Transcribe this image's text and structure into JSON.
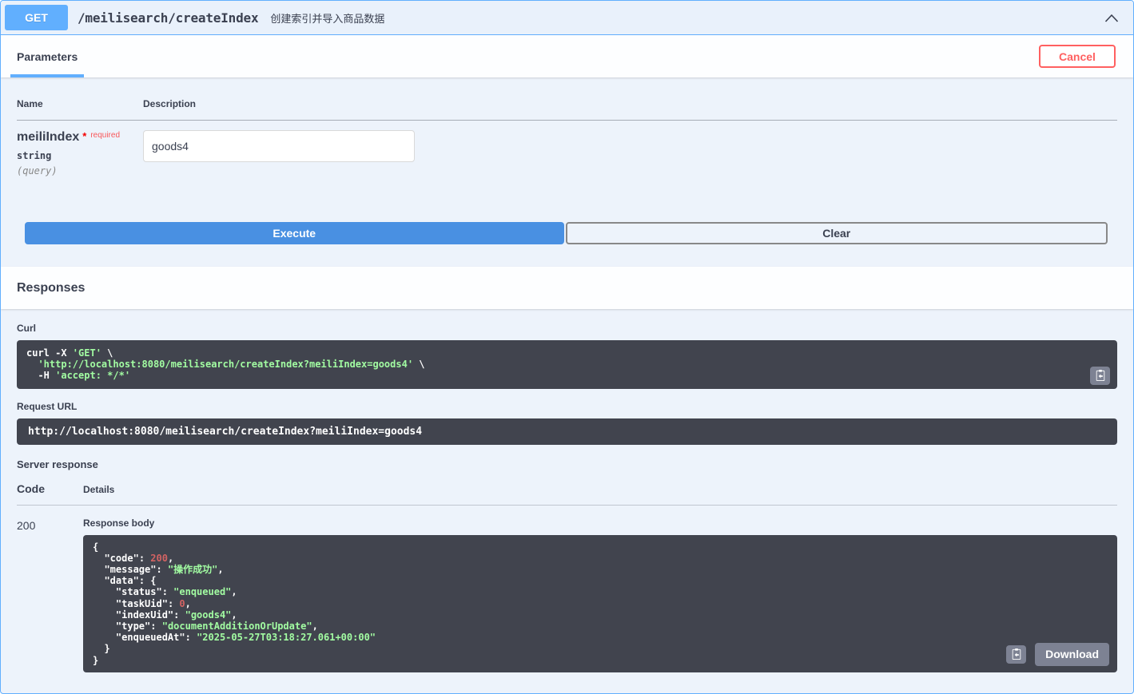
{
  "colors": {
    "method_get": "#61affe",
    "execute_blue": "#4990e2",
    "cancel_red": "#ff6060",
    "code_block_bg": "#41444e",
    "token_string_green": "#a2fca2",
    "token_number_red": "#d36363",
    "gray_button": "#7d8293"
  },
  "summary": {
    "method": "GET",
    "path": "/meilisearch/createIndex",
    "description": "创建索引并导入商品数据"
  },
  "parameters_section": {
    "tab_label": "Parameters",
    "cancel_label": "Cancel",
    "table": {
      "name_header": "Name",
      "description_header": "Description"
    },
    "param": {
      "name": "meiliIndex",
      "required_star": "*",
      "required_label": "required",
      "type": "string",
      "location": "(query)",
      "value": "goods4"
    },
    "execute_label": "Execute",
    "clear_label": "Clear"
  },
  "responses_section": {
    "title": "Responses",
    "curl_label": "Curl",
    "curl_lines": [
      [
        [
          "plain",
          "curl -X "
        ],
        [
          "str",
          "'GET'"
        ],
        [
          "plain",
          " \\"
        ]
      ],
      [
        [
          "str",
          "  'http://localhost:8080/meilisearch/createIndex?meiliIndex=goods4'"
        ],
        [
          "plain",
          " \\"
        ]
      ],
      [
        [
          "plain",
          "  -H "
        ],
        [
          "str",
          "'accept: */*'"
        ]
      ]
    ],
    "request_url_label": "Request URL",
    "request_url": "http://localhost:8080/meilisearch/createIndex?meiliIndex=goods4",
    "server_response_label": "Server response",
    "code_header": "Code",
    "details_header": "Details",
    "response": {
      "code": "200",
      "body_label": "Response body",
      "body_lines": [
        [
          [
            "plain",
            "{"
          ]
        ],
        [
          [
            "plain",
            "  "
          ],
          [
            "key",
            "\"code\""
          ],
          [
            "plain",
            ": "
          ],
          [
            "num",
            "200"
          ],
          [
            "plain",
            ","
          ]
        ],
        [
          [
            "plain",
            "  "
          ],
          [
            "key",
            "\"message\""
          ],
          [
            "plain",
            ": "
          ],
          [
            "str",
            "\"操作成功\""
          ],
          [
            "plain",
            ","
          ]
        ],
        [
          [
            "plain",
            "  "
          ],
          [
            "key",
            "\"data\""
          ],
          [
            "plain",
            ": {"
          ]
        ],
        [
          [
            "plain",
            "    "
          ],
          [
            "key",
            "\"status\""
          ],
          [
            "plain",
            ": "
          ],
          [
            "str",
            "\"enqueued\""
          ],
          [
            "plain",
            ","
          ]
        ],
        [
          [
            "plain",
            "    "
          ],
          [
            "key",
            "\"taskUid\""
          ],
          [
            "plain",
            ": "
          ],
          [
            "num",
            "0"
          ],
          [
            "plain",
            ","
          ]
        ],
        [
          [
            "plain",
            "    "
          ],
          [
            "key",
            "\"indexUid\""
          ],
          [
            "plain",
            ": "
          ],
          [
            "str",
            "\"goods4\""
          ],
          [
            "plain",
            ","
          ]
        ],
        [
          [
            "plain",
            "    "
          ],
          [
            "key",
            "\"type\""
          ],
          [
            "plain",
            ": "
          ],
          [
            "str",
            "\"documentAdditionOrUpdate\""
          ],
          [
            "plain",
            ","
          ]
        ],
        [
          [
            "plain",
            "    "
          ],
          [
            "key",
            "\"enqueuedAt\""
          ],
          [
            "plain",
            ": "
          ],
          [
            "str",
            "\"2025-05-27T03:18:27.061+00:00\""
          ]
        ],
        [
          [
            "plain",
            "  }"
          ]
        ],
        [
          [
            "plain",
            "}"
          ]
        ]
      ],
      "download_label": "Download"
    }
  }
}
